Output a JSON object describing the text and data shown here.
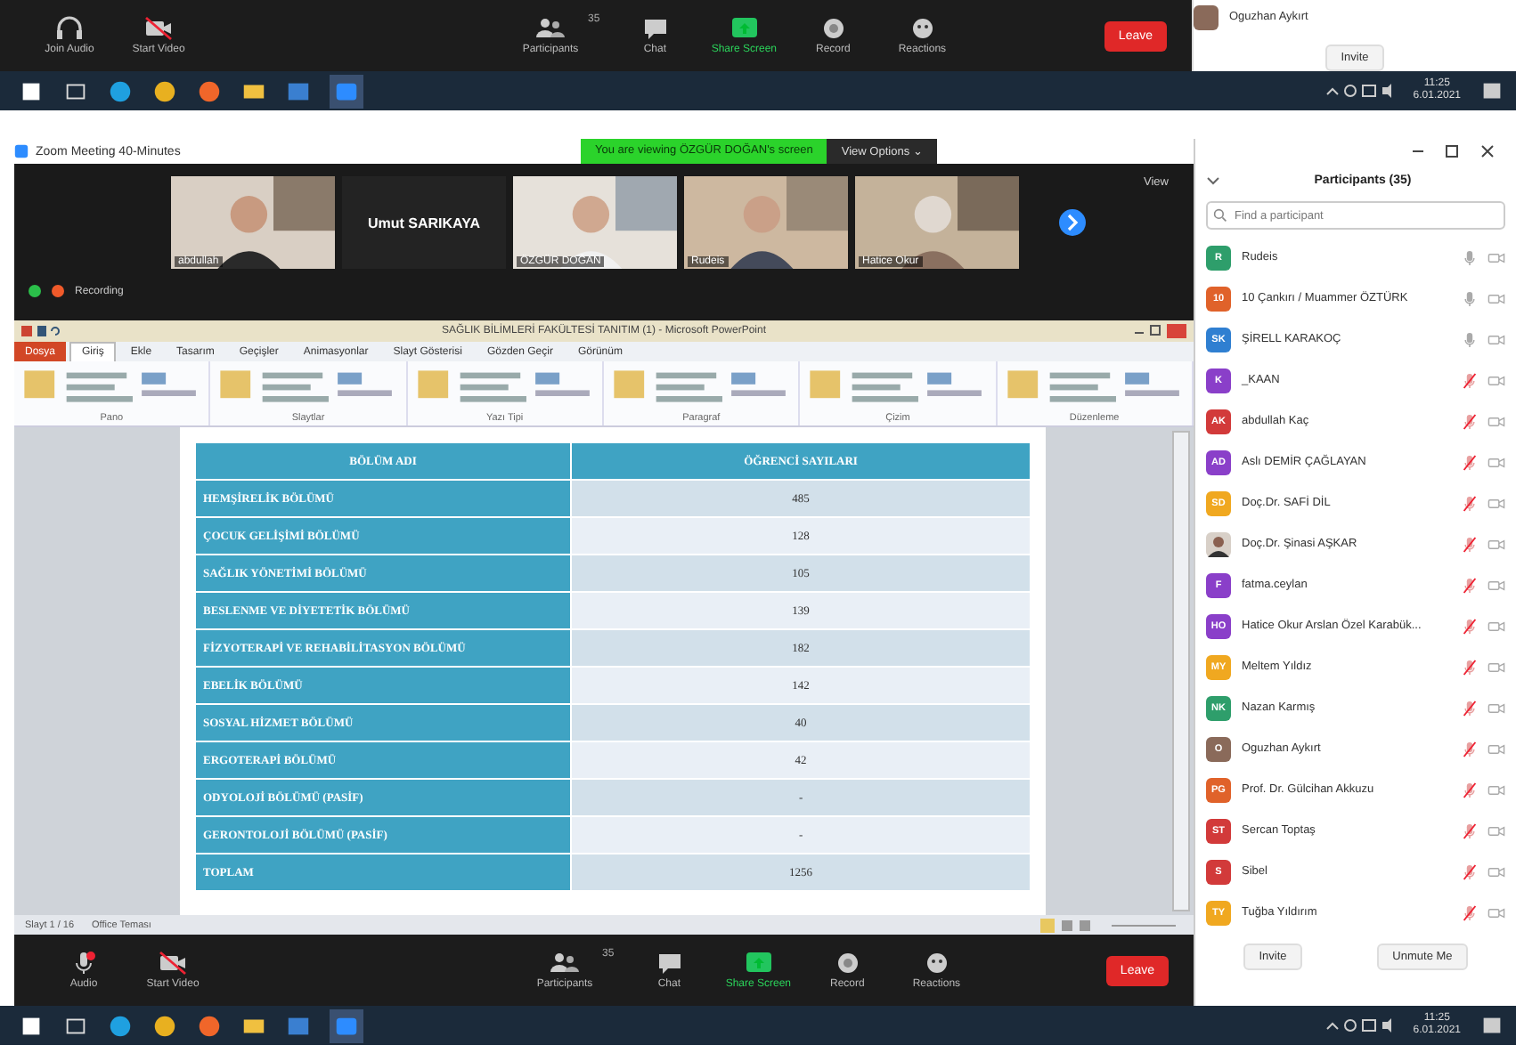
{
  "top_meeting_toolbar": {
    "items": [
      {
        "label": "Join Audio",
        "kind": "audio"
      },
      {
        "label": "Start Video",
        "kind": "video"
      },
      {
        "label": "Participants",
        "kind": "participants",
        "count": "35"
      },
      {
        "label": "Chat",
        "kind": "chat"
      },
      {
        "label": "Share Screen",
        "kind": "share"
      },
      {
        "label": "Record",
        "kind": "record"
      },
      {
        "label": "Reactions",
        "kind": "reactions"
      }
    ],
    "leave": "Leave"
  },
  "top_panel": {
    "name": "Oguzhan Aykırt",
    "invite": "Invite"
  },
  "top_taskbar": {
    "time": "11:25",
    "date": "6.01.2021"
  },
  "window": {
    "title": "Zoom Meeting 40-Minutes",
    "banner": "You are viewing ÖZGÜR DOĞAN's screen",
    "view_options": "View Options ⌄",
    "view": "View",
    "recording": "Recording"
  },
  "videos": [
    {
      "name": "abdullah",
      "kind": "video"
    },
    {
      "name": "Umut SARIKAYA",
      "kind": "name"
    },
    {
      "name": "ÖZGÜR DOĞAN",
      "kind": "video"
    },
    {
      "name": "Rudeis",
      "kind": "video"
    },
    {
      "name": "Hatice Okur",
      "kind": "video"
    }
  ],
  "powerpoint": {
    "title": "SAĞLIK BİLİMLERİ FAKÜLTESİ TANITIM (1) - Microsoft PowerPoint",
    "tabs": [
      {
        "label": "Dosya",
        "kind": "file",
        "selected": false
      },
      {
        "label": "Giriş",
        "kind": "tab",
        "selected": true
      },
      {
        "label": "Ekle",
        "kind": "tab",
        "selected": false
      },
      {
        "label": "Tasarım",
        "kind": "tab",
        "selected": false
      },
      {
        "label": "Geçişler",
        "kind": "tab",
        "selected": false
      },
      {
        "label": "Animasyonlar",
        "kind": "tab",
        "selected": false
      },
      {
        "label": "Slayt Gösterisi",
        "kind": "tab",
        "selected": false
      },
      {
        "label": "Gözden Geçir",
        "kind": "tab",
        "selected": false
      },
      {
        "label": "Görünüm",
        "kind": "tab",
        "selected": false
      }
    ],
    "groups": [
      "Pano",
      "Slaytlar",
      "Yazı Tipi",
      "Paragraf",
      "Çizim",
      "Düzenleme"
    ],
    "table": {
      "columns": [
        "BÖLÜM ADI",
        "ÖĞRENCİ SAYILARI"
      ],
      "rows": [
        [
          "HEMŞİRELİK BÖLÜMÜ",
          "485"
        ],
        [
          "ÇOCUK GELİŞİMİ BÖLÜMÜ",
          "128"
        ],
        [
          "SAĞLIK YÖNETİMİ BÖLÜMÜ",
          "105"
        ],
        [
          "BESLENME VE DİYETETİK BÖLÜMÜ",
          "139"
        ],
        [
          "FİZYOTERAPİ VE REHABİLİTASYON BÖLÜMÜ",
          "182"
        ],
        [
          "EBELİK BÖLÜMÜ",
          "142"
        ],
        [
          "SOSYAL HİZMET BÖLÜMÜ",
          "40"
        ],
        [
          "ERGOTERAPİ BÖLÜMÜ",
          "42"
        ],
        [
          "ODYOLOJİ BÖLÜMÜ (PASİF)",
          "-"
        ],
        [
          "GERONTOLOJİ BÖLÜMÜ (PASİF)",
          "-"
        ],
        [
          "TOPLAM",
          "1256"
        ]
      ]
    },
    "status": [
      "Slayt 1 / 16",
      "Office Teması"
    ]
  },
  "meeting_toolbar": {
    "items": [
      {
        "label": "Audio",
        "kind": "audio_muted"
      },
      {
        "label": "Start Video",
        "kind": "video"
      },
      {
        "label": "Participants",
        "kind": "participants",
        "count": "35"
      },
      {
        "label": "Chat",
        "kind": "chat"
      },
      {
        "label": "Share Screen",
        "kind": "share"
      },
      {
        "label": "Record",
        "kind": "record"
      },
      {
        "label": "Reactions",
        "kind": "reactions"
      }
    ],
    "leave": "Leave"
  },
  "participants": {
    "title": "Participants (35)",
    "search": {
      "placeholder": "Find a participant"
    },
    "items": [
      {
        "initials": "R",
        "name": "Rudeis",
        "color": "#2e9e6b",
        "kind": "initials",
        "muted": false
      },
      {
        "initials": "10",
        "name": "10 Çankırı / Muammer ÖZTÜRK",
        "color": "#e0622a",
        "kind": "initials",
        "muted": false
      },
      {
        "initials": "SK",
        "name": "ŞİRELL KARAKOÇ",
        "color": "#2f7fd1",
        "kind": "initials",
        "muted": false
      },
      {
        "initials": "K",
        "name": "_KAAN",
        "color": "#8a3fc9",
        "kind": "initials",
        "muted": true
      },
      {
        "initials": "AK",
        "name": "abdullah Kaç",
        "color": "#d23a3a",
        "kind": "initials",
        "muted": true
      },
      {
        "initials": "AD",
        "name": "Aslı DEMİR ÇAĞLAYAN",
        "color": "#8a3fc9",
        "kind": "initials",
        "muted": true
      },
      {
        "initials": "SD",
        "name": "Doç.Dr. SAFİ DİL",
        "color": "#f0a820",
        "kind": "initials",
        "muted": true
      },
      {
        "name": "Doç.Dr. Şinasi AŞKAR",
        "muted": true
      },
      {
        "initials": "F",
        "name": "fatma.ceylan",
        "color": "#8a3fc9",
        "kind": "initials",
        "muted": true
      },
      {
        "initials": "HO",
        "name": "Hatice Okur Arslan Özel Karabük...",
        "color": "#8a3fc9",
        "kind": "initials",
        "muted": true
      },
      {
        "initials": "MY",
        "name": "Meltem Yıldız",
        "color": "#f0a820",
        "kind": "initials",
        "muted": true
      },
      {
        "initials": "NK",
        "name": "Nazan Karmış",
        "color": "#2e9e6b",
        "kind": "initials",
        "muted": true
      },
      {
        "initials": "O",
        "name": "Oguzhan Aykırt",
        "color": "#8a6a5a",
        "kind": "initials",
        "muted": true
      },
      {
        "initials": "PG",
        "name": "Prof. Dr. Gülcihan Akkuzu",
        "color": "#e0622a",
        "kind": "initials",
        "muted": true
      },
      {
        "initials": "ST",
        "name": "Sercan Toptaş",
        "color": "#d23a3a",
        "kind": "initials",
        "muted": true
      },
      {
        "initials": "S",
        "name": "Sibel",
        "color": "#d23a3a",
        "kind": "initials",
        "muted": true
      },
      {
        "initials": "TY",
        "name": "Tuğba Yıldırım",
        "color": "#f0a820",
        "kind": "initials",
        "muted": true
      }
    ],
    "buttons": [
      "Invite",
      "Unmute Me"
    ]
  },
  "taskbar": {
    "time": "11:25",
    "date": "6.01.2021"
  }
}
